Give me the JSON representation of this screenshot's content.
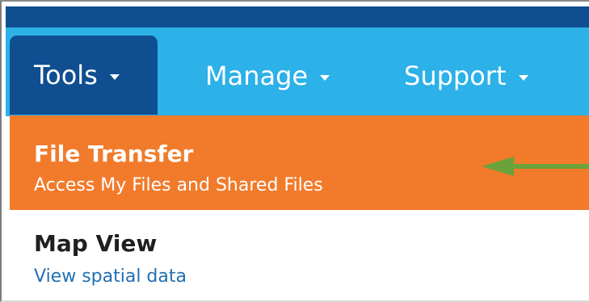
{
  "nav": {
    "items": [
      {
        "label": "Tools"
      },
      {
        "label": "Manage"
      },
      {
        "label": "Support"
      }
    ]
  },
  "dropdown": {
    "items": [
      {
        "title": "File Transfer",
        "subtitle": "Access My Files and Shared Files"
      },
      {
        "title": "Map View",
        "subtitle": "View spatial data"
      }
    ]
  },
  "colors": {
    "top_strip": "#0f4f91",
    "nav_bar": "#2cb1e8",
    "active_tab": "#0f4f91",
    "highlight_item": "#f17b2b",
    "arrow": "#6aa33a",
    "link_text": "#226fb3"
  },
  "icons": {
    "chevron": "chevron-down-icon",
    "annotation_arrow": "arrow-left-icon"
  }
}
